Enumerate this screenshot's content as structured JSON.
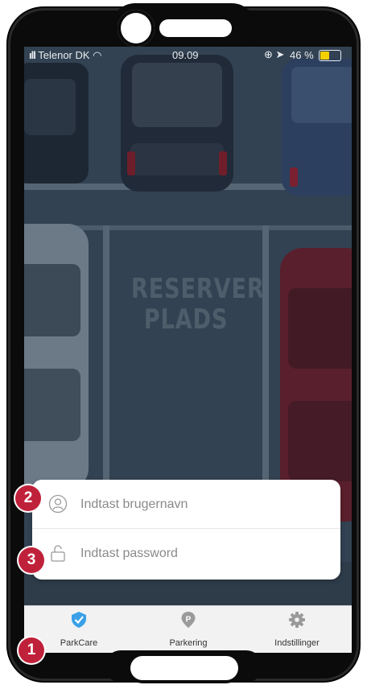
{
  "status_bar": {
    "carrier": "Telenor DK",
    "time": "09.09",
    "battery_percent": "46 %"
  },
  "background": {
    "painted_text_line1": "RESERVER",
    "painted_text_line2": "PLADS"
  },
  "login": {
    "username_placeholder": "Indtast brugernavn",
    "password_placeholder": "Indtast password"
  },
  "tabs": [
    {
      "label": "ParkCare",
      "icon": "shield-check-icon",
      "color": "#3aa0e8"
    },
    {
      "label": "Parkering",
      "icon": "parking-pin-icon",
      "color": "#9a9a9a"
    },
    {
      "label": "Indstillinger",
      "icon": "gear-icon",
      "color": "#9a9a9a"
    }
  ],
  "badges": [
    "1",
    "2",
    "3"
  ],
  "colors": {
    "badge": "#c0213a",
    "accent": "#3aa0e8",
    "battery": "#f5d000"
  }
}
